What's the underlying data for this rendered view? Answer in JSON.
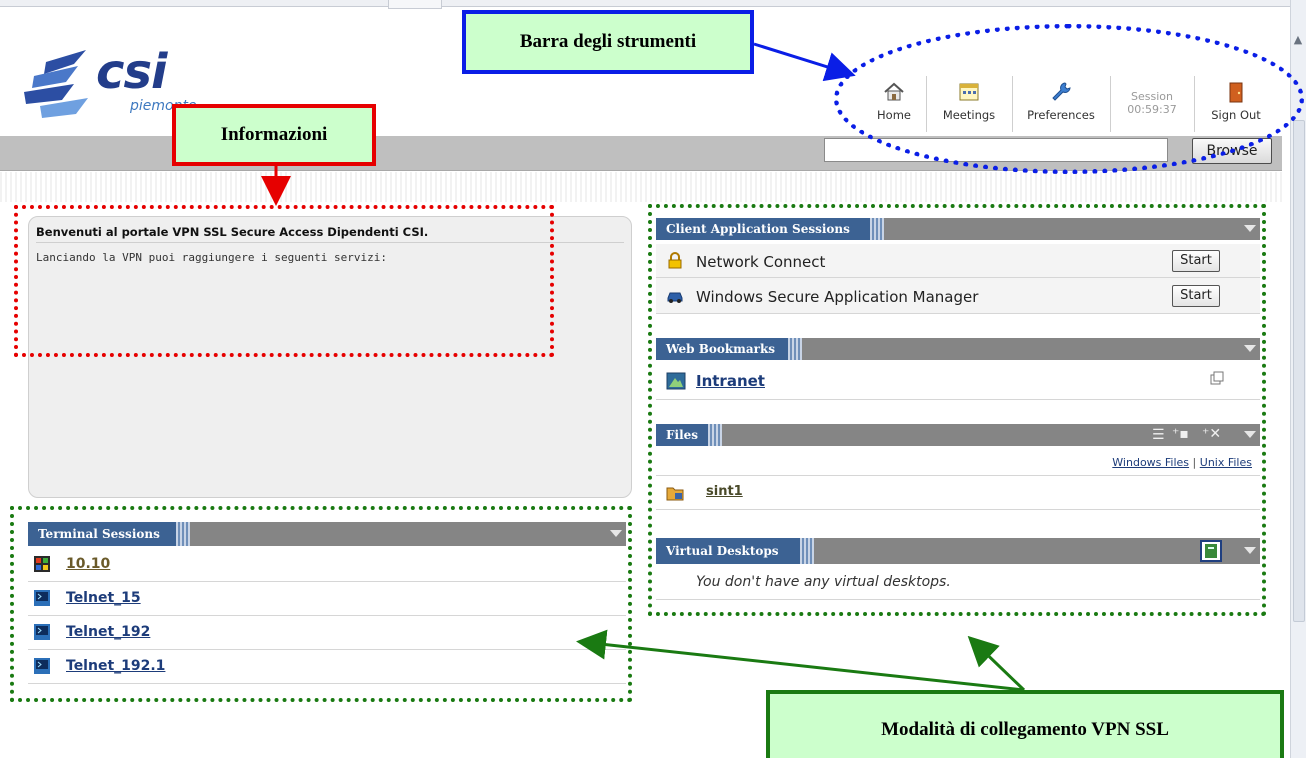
{
  "logo": {
    "name": "csi",
    "sub": "piemonte"
  },
  "toolbar": {
    "home_label": "Home",
    "meetings_label": "Meetings",
    "preferences_label": "Preferences",
    "session_label": "Session",
    "session_time": "00:59:37",
    "signout_label": "Sign Out"
  },
  "search": {
    "value": "",
    "browse_label": "Browse"
  },
  "welcome": {
    "title": "Benvenuti al portale VPN SSL Secure Access Dipendenti CSI.",
    "body": "Lanciando la VPN puoi raggiungere i seguenti servizi:"
  },
  "client_apps": {
    "header": "Client Application Sessions",
    "items": [
      {
        "label": "Network Connect",
        "button": "Start",
        "icon": "lock-icon"
      },
      {
        "label": "Windows Secure Application Manager",
        "button": "Start",
        "icon": "car-icon"
      }
    ]
  },
  "web_bookmarks": {
    "header": "Web Bookmarks",
    "items": [
      {
        "label": "Intranet"
      }
    ]
  },
  "files": {
    "header": "Files",
    "windows_link": "Windows Files",
    "separator": "|",
    "unix_link": "Unix Files",
    "items": [
      {
        "label": "sint1"
      }
    ]
  },
  "virtual_desktops": {
    "header": "Virtual Desktops",
    "empty_message": "You don't have any virtual desktops."
  },
  "terminal_sessions": {
    "header": "Terminal Sessions",
    "items": [
      {
        "label": "10.10",
        "icon": "windows-terminal-icon"
      },
      {
        "label": "Telnet_15",
        "icon": "telnet-icon"
      },
      {
        "label": "Telnet_192",
        "icon": "telnet-icon"
      },
      {
        "label": "Telnet_192.1",
        "icon": "telnet-icon"
      }
    ]
  },
  "annotations": {
    "toolbar": "Barra degli strumenti",
    "info": "Informazioni",
    "modes": "Modalità di collegamento VPN SSL"
  },
  "colors": {
    "panel_header": "#3c6293",
    "panel_bar": "#858585",
    "annotation_blue": "#0a1ee6",
    "annotation_red": "#e60000",
    "annotation_green": "#1a7a12",
    "callout_bg": "#ccffcc"
  }
}
